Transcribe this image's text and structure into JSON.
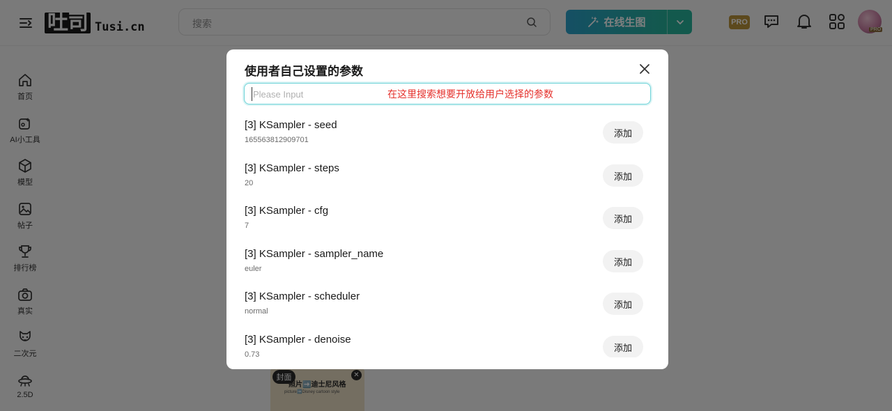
{
  "header": {
    "logo_mark": "吐司",
    "logo_text": "Tusi.cn",
    "search_placeholder": "搜索",
    "generate_button": "在线生图",
    "pro_badge": "PRO",
    "avatar_badge": "PRO"
  },
  "sidebar": {
    "items": [
      {
        "label": "首页",
        "icon": "home-icon"
      },
      {
        "label": "AI小工具",
        "icon": "ai-tools-icon"
      },
      {
        "label": "模型",
        "icon": "model-cube-icon"
      },
      {
        "label": "帖子",
        "icon": "post-image-icon"
      },
      {
        "label": "排行榜",
        "icon": "trophy-icon"
      },
      {
        "label": "真实",
        "icon": "camera-icon"
      },
      {
        "label": "二次元",
        "icon": "anime-cat-icon"
      },
      {
        "label": "2.5D",
        "icon": "ufo-icon"
      }
    ]
  },
  "background": {
    "card_chip": "封面",
    "card_title": "照片➡️迪士尼风格",
    "card_subtitle": "picture➡️Disney cartoon style"
  },
  "modal": {
    "title": "使用者自己设置的参数",
    "input_placeholder": "Please Input",
    "annotation": "在这里搜索想要开放给用户选择的参数",
    "add_label": "添加",
    "params": [
      {
        "name": "[3] KSampler - seed",
        "value": "165563812909701"
      },
      {
        "name": "[3] KSampler - steps",
        "value": "20"
      },
      {
        "name": "[3] KSampler - cfg",
        "value": "7"
      },
      {
        "name": "[3] KSampler - sampler_name",
        "value": "euler"
      },
      {
        "name": "[3] KSampler - scheduler",
        "value": "normal"
      },
      {
        "name": "[3] KSampler - denoise",
        "value": "0.73"
      }
    ]
  },
  "colors": {
    "accent_teal": "#6ed3d8",
    "annotation_red": "#e5322d",
    "generate_gradient_start": "#2aa0c9",
    "generate_gradient_end": "#27b29a"
  }
}
